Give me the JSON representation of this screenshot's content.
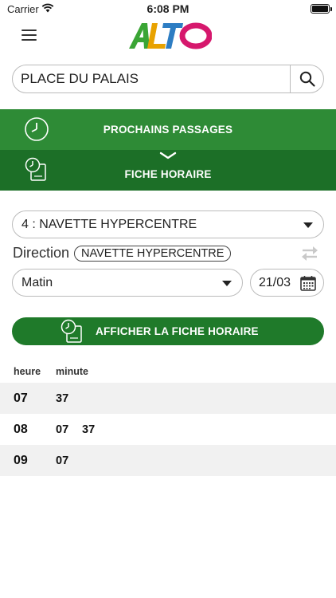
{
  "status_bar": {
    "carrier": "Carrier",
    "time": "6:08 PM"
  },
  "header": {
    "logo_text": "ALTO"
  },
  "search": {
    "value": "PLACE DU PALAIS"
  },
  "tabs": [
    {
      "label": "PROCHAINS PASSAGES",
      "active": false
    },
    {
      "label": "FICHE HORAIRE",
      "active": true
    }
  ],
  "line_select": {
    "value": "4 : NAVETTE HYPERCENTRE"
  },
  "direction": {
    "label": "Direction",
    "value": "NAVETTE HYPERCENTRE"
  },
  "period_select": {
    "value": "Matin"
  },
  "date_select": {
    "value": "21/03"
  },
  "show_button": {
    "label": "AFFICHER LA FICHE HORAIRE"
  },
  "timetable": {
    "headers": {
      "hour": "heure",
      "minute": "minute"
    },
    "rows": [
      {
        "hour": "07",
        "minutes": [
          "37"
        ]
      },
      {
        "hour": "08",
        "minutes": [
          "07",
          "37"
        ]
      },
      {
        "hour": "09",
        "minutes": [
          "07"
        ]
      }
    ]
  },
  "colors": {
    "green": "#2e8b36",
    "dark_green": "#1c6f27",
    "button_green": "#1f7a2a"
  }
}
